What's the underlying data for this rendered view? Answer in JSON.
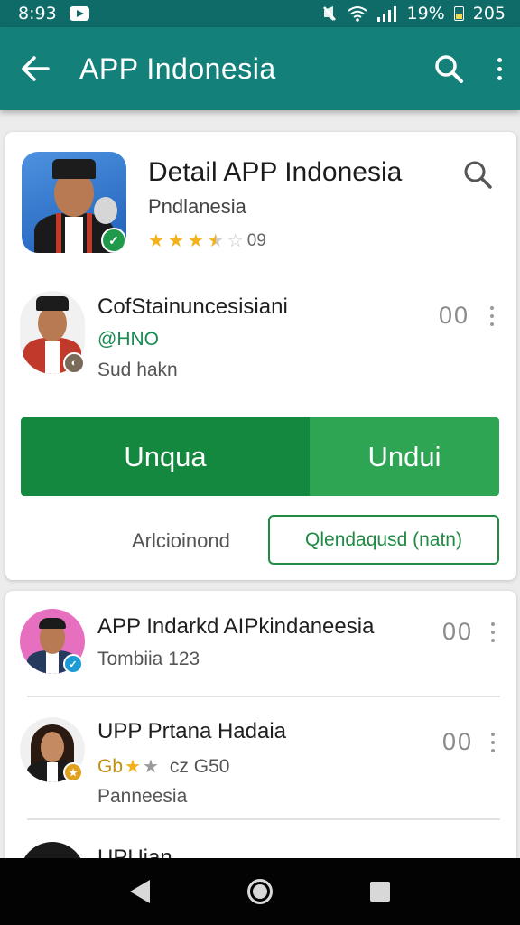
{
  "status_bar": {
    "time": "8:93",
    "battery": "19%",
    "extra": "205"
  },
  "app_bar": {
    "title": "APP Indonesia"
  },
  "detail": {
    "title": "Detail APP Indonesia",
    "subtitle": "Pndlanesia",
    "rating_value": "09",
    "stars_filled": 3.5,
    "stars_total": 5
  },
  "featured_item": {
    "title": "CofStainuncesisiani",
    "handle": "@HNO",
    "meta": "Sud hakn",
    "count": "00"
  },
  "install": {
    "primary_label": "Unqua",
    "secondary_label": "Undui"
  },
  "actions": {
    "link_label": "Arlcioinond",
    "outline_label": "Qlendaqusd (natn)"
  },
  "list": [
    {
      "title": "APP Indarkd AIPkindaneesia",
      "line2": "Tombiia 123",
      "count": "00"
    },
    {
      "title": "UPP Prtana Hadaia",
      "line2_prefix": "Gb",
      "line2_suffix": "cz G50",
      "line3": "Panneesia",
      "count": "00"
    },
    {
      "title": "UPUian"
    }
  ],
  "colors": {
    "appbar": "#13807a",
    "statusbar": "#0e6b67",
    "install_primary": "#14883e",
    "install_secondary": "#2da553",
    "star": "#f2b21a"
  }
}
